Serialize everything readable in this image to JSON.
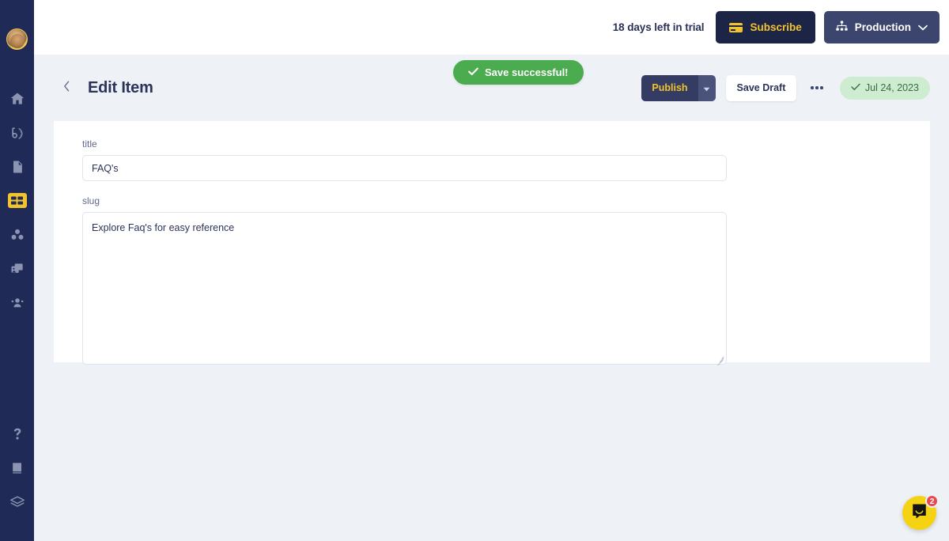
{
  "sidebar": {
    "avatar_name": "user-avatar",
    "items": [
      {
        "name": "home-icon",
        "label": "Home"
      },
      {
        "name": "broadcast-icon",
        "label": "Broadcast"
      },
      {
        "name": "document-icon",
        "label": "Pages"
      },
      {
        "name": "collections-icon",
        "label": "Collections",
        "active": true
      },
      {
        "name": "blocks-icon",
        "label": "Blocks"
      },
      {
        "name": "media-icon",
        "label": "Media"
      },
      {
        "name": "users-icon",
        "label": "Users"
      }
    ],
    "bottom_items": [
      {
        "name": "help-icon",
        "label": "Help"
      },
      {
        "name": "book-icon",
        "label": "Docs"
      },
      {
        "name": "layers-icon",
        "label": "Layers"
      }
    ]
  },
  "topbar": {
    "trial_text": "18 days left in trial",
    "subscribe_label": "Subscribe",
    "subscribe_icon": "credit-card-icon",
    "environment_label": "Production",
    "environment_icon": "sitemap-icon",
    "environment_caret": "chevron-down-icon",
    "accent_yellow": "#f2c32c",
    "navy": "#1d2546"
  },
  "toast": {
    "message": "Save successful!",
    "icon": "check-icon",
    "color": "#4aab4f"
  },
  "page_header": {
    "back_icon": "chevron-left-icon",
    "title": "Edit Item",
    "publish_label": "Publish",
    "publish_caret_icon": "caret-down-icon",
    "save_draft_label": "Save Draft",
    "more_icon": "ellipsis-icon",
    "date_badge": {
      "icon": "check-icon",
      "text": "Jul 24, 2023",
      "bg": "#cdecd0",
      "fg": "#3b6a49"
    }
  },
  "form": {
    "fields": [
      {
        "label": "title",
        "value": "FAQ's",
        "placeholder": "",
        "type": "text"
      },
      {
        "label": "slug",
        "value": "Explore Faq's for easy reference",
        "placeholder": "",
        "type": "textarea"
      }
    ]
  },
  "chat": {
    "icon": "chat-bubble-icon",
    "badge_count": "2",
    "bg": "#f5d312",
    "badge_bg": "#e8484e"
  }
}
